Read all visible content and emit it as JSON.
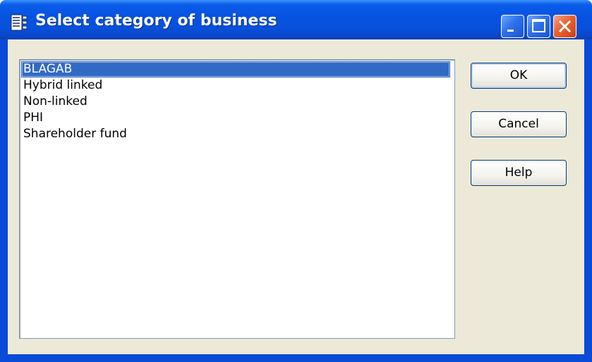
{
  "window": {
    "title": "Select category of business"
  },
  "list": {
    "items": [
      {
        "label": "BLAGAB",
        "selected": true
      },
      {
        "label": "Hybrid linked",
        "selected": false
      },
      {
        "label": "Non-linked",
        "selected": false
      },
      {
        "label": "PHI",
        "selected": false
      },
      {
        "label": "Shareholder fund",
        "selected": false
      }
    ]
  },
  "buttons": {
    "ok_label": "OK",
    "cancel_label": "Cancel",
    "help_label": "Help"
  },
  "colors": {
    "titlebar": "#0652e0",
    "selection": "#316ac5",
    "dialog_face": "#ece9d8"
  },
  "icons": {
    "title": "dialog-list-icon",
    "minimize": "minimize-icon",
    "maximize": "maximize-icon",
    "close": "close-icon"
  }
}
